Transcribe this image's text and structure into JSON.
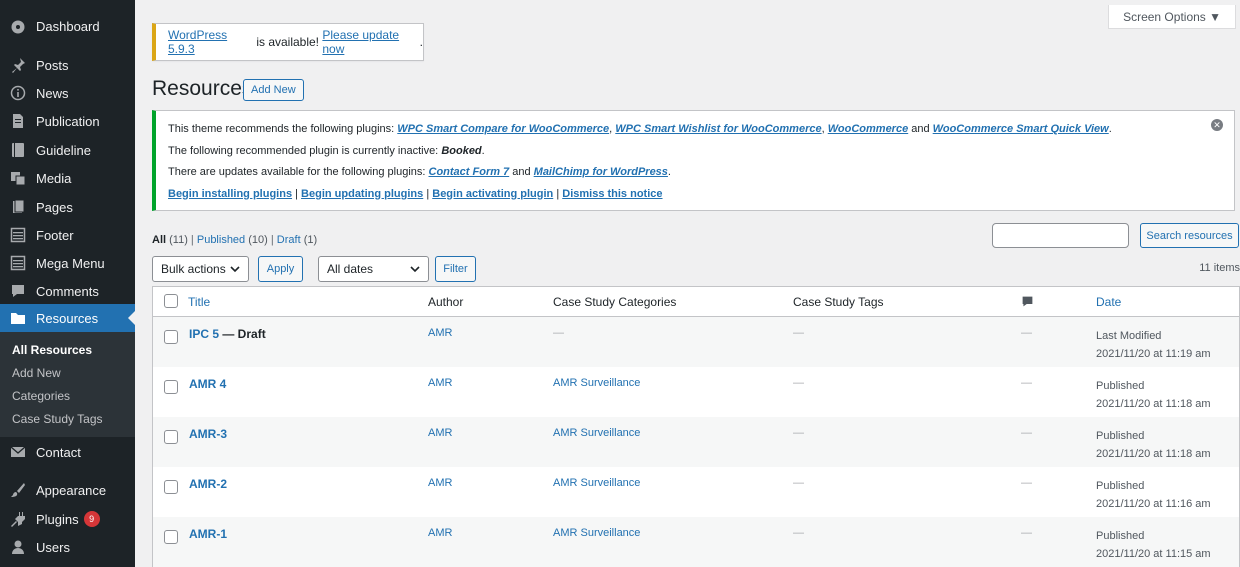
{
  "sidebar": {
    "items": [
      {
        "label": "Dashboard",
        "icon": "dashboard-icon"
      },
      {
        "label": "Posts",
        "icon": "pin-icon"
      },
      {
        "label": "News",
        "icon": "info-icon"
      },
      {
        "label": "Publication",
        "icon": "document-icon"
      },
      {
        "label": "Guideline",
        "icon": "book-icon"
      },
      {
        "label": "Media",
        "icon": "media-icon"
      },
      {
        "label": "Pages",
        "icon": "pages-icon"
      },
      {
        "label": "Footer",
        "icon": "layout-icon"
      },
      {
        "label": "Mega Menu",
        "icon": "layout-icon"
      },
      {
        "label": "Comments",
        "icon": "comment-icon"
      },
      {
        "label": "Resources",
        "icon": "folder-icon"
      },
      {
        "label": "Contact",
        "icon": "mail-icon"
      },
      {
        "label": "Appearance",
        "icon": "brush-icon"
      },
      {
        "label": "Plugins",
        "icon": "plug-icon",
        "badge": "9"
      },
      {
        "label": "Users",
        "icon": "user-icon"
      }
    ],
    "submenu": [
      "All Resources",
      "Add New",
      "Categories",
      "Case Study Tags"
    ]
  },
  "screen_options": "Screen Options ▼",
  "update_nag": {
    "link1": "WordPress 5.9.3",
    "mid": " is available! ",
    "link2": "Please update now",
    "end": "."
  },
  "page": {
    "title": "Resources",
    "add_new": "Add New"
  },
  "notice": {
    "line1_prefix": "This theme recommends the following plugins: ",
    "plugins": [
      "WPC Smart Compare for WooCommerce",
      "WPC Smart Wishlist for WooCommerce",
      "WooCommerce",
      "WooCommerce Smart Quick View"
    ],
    "sep1": ", ",
    "sep2": ", ",
    "and": " and ",
    "end": ".",
    "line2_prefix": "The following recommended plugin is currently inactive: ",
    "inactive": "Booked",
    "line3_prefix": "There are updates available for the following plugins: ",
    "updates": [
      "Contact Form 7",
      "MailChimp for WordPress"
    ],
    "links": [
      "Begin installing plugins",
      "Begin updating plugins",
      "Begin activating plugin",
      "Dismiss this notice"
    ],
    "pipe": " | "
  },
  "filters": {
    "all": "All",
    "all_count": "(11)",
    "published": "Published",
    "published_count": "(10)",
    "draft": "Draft",
    "draft_count": "(1)",
    "sep": " | "
  },
  "search": {
    "button": "Search resources",
    "value": ""
  },
  "bulk": {
    "selected": "Bulk actions",
    "apply": "Apply",
    "dates": "All dates",
    "filter": "Filter"
  },
  "items_count": "11 items",
  "table": {
    "headers": {
      "title": "Title",
      "author": "Author",
      "categories": "Case Study Categories",
      "tags": "Case Study Tags",
      "comments_icon": "comment-icon",
      "date": "Date"
    },
    "rows": [
      {
        "title": "IPC 5",
        "state": " — Draft",
        "author": "AMR",
        "category": "—",
        "tags": "—",
        "comments": "—",
        "status": "Last Modified",
        "date": "2021/11/20 at 11:19 am"
      },
      {
        "title": "AMR 4",
        "state": "",
        "author": "AMR",
        "category": "AMR Surveillance",
        "tags": "—",
        "comments": "—",
        "status": "Published",
        "date": "2021/11/20 at 11:18 am"
      },
      {
        "title": "AMR-3",
        "state": "",
        "author": "AMR",
        "category": "AMR Surveillance",
        "tags": "—",
        "comments": "—",
        "status": "Published",
        "date": "2021/11/20 at 11:18 am"
      },
      {
        "title": "AMR-2",
        "state": "",
        "author": "AMR",
        "category": "AMR Surveillance",
        "tags": "—",
        "comments": "—",
        "status": "Published",
        "date": "2021/11/20 at 11:16 am"
      },
      {
        "title": "AMR-1",
        "state": "",
        "author": "AMR",
        "category": "AMR Surveillance",
        "tags": "—",
        "comments": "—",
        "status": "Published",
        "date": "2021/11/20 at 11:15 am"
      }
    ]
  }
}
